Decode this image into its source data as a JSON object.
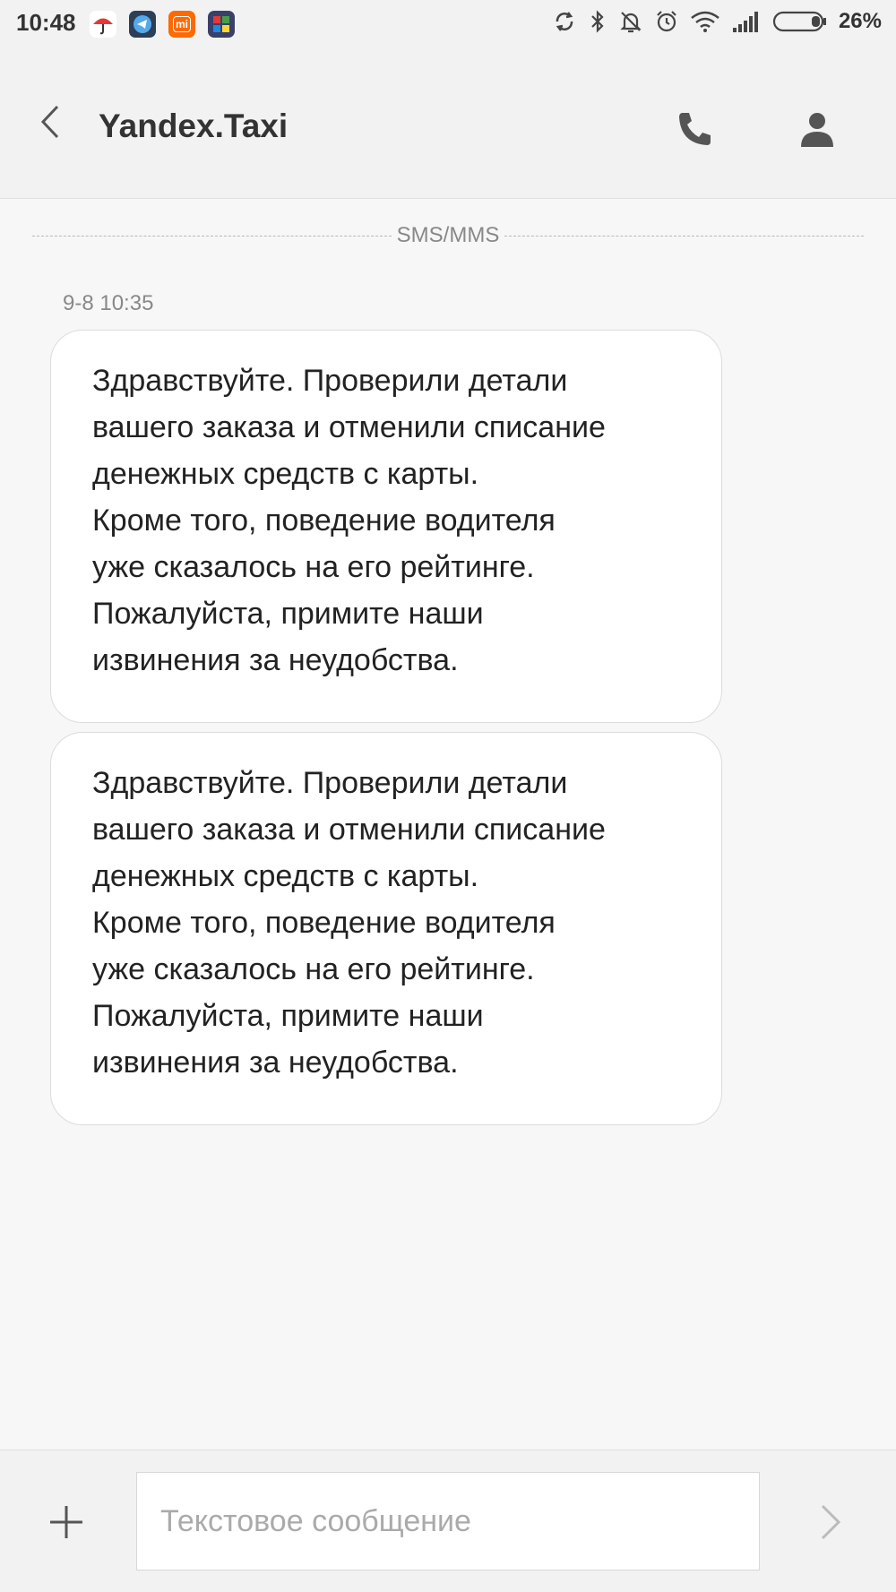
{
  "status_bar": {
    "time": "10:48",
    "app_icons": [
      "umbrella-icon",
      "telegram-icon",
      "mi-icon",
      "puzzle-icon"
    ],
    "mi_label": "mi",
    "system_icons": [
      "sync-icon",
      "bluetooth-icon",
      "mute-icon",
      "alarm-icon",
      "wifi-icon",
      "signal-icon",
      "battery-icon"
    ],
    "battery": "26%"
  },
  "header": {
    "title": "Yandex.Taxi",
    "back_icon": "chevron-left-icon",
    "call_icon": "phone-icon",
    "contact_icon": "person-icon"
  },
  "conversation": {
    "channel_label": "SMS/MMS",
    "timestamp": "9-8 10:35",
    "messages": [
      {
        "text": "Здравствуйте. Проверили детали\nвашего заказа и отменили списание\nденежных средств с карты.\nКроме того, поведение водителя\nуже сказалось на его рейтинге.\nПожалуйста, примите наши\nизвинения за неудобства."
      },
      {
        "text": "Здравствуйте. Проверили детали\nвашего заказа и отменили списание\nденежных средств с карты.\nКроме того, поведение водителя\nуже сказалось на его рейтинге.\nПожалуйста, примите наши\nизвинения за неудобства."
      }
    ]
  },
  "composer": {
    "placeholder": "Текстовое сообщение",
    "value": "",
    "add_icon": "plus-icon",
    "send_icon": "chevron-right-icon"
  },
  "colors": {
    "background": "#f7f7f7",
    "bar": "#f2f2f2",
    "bubble": "#ffffff",
    "text": "#222222",
    "muted": "#888888"
  }
}
